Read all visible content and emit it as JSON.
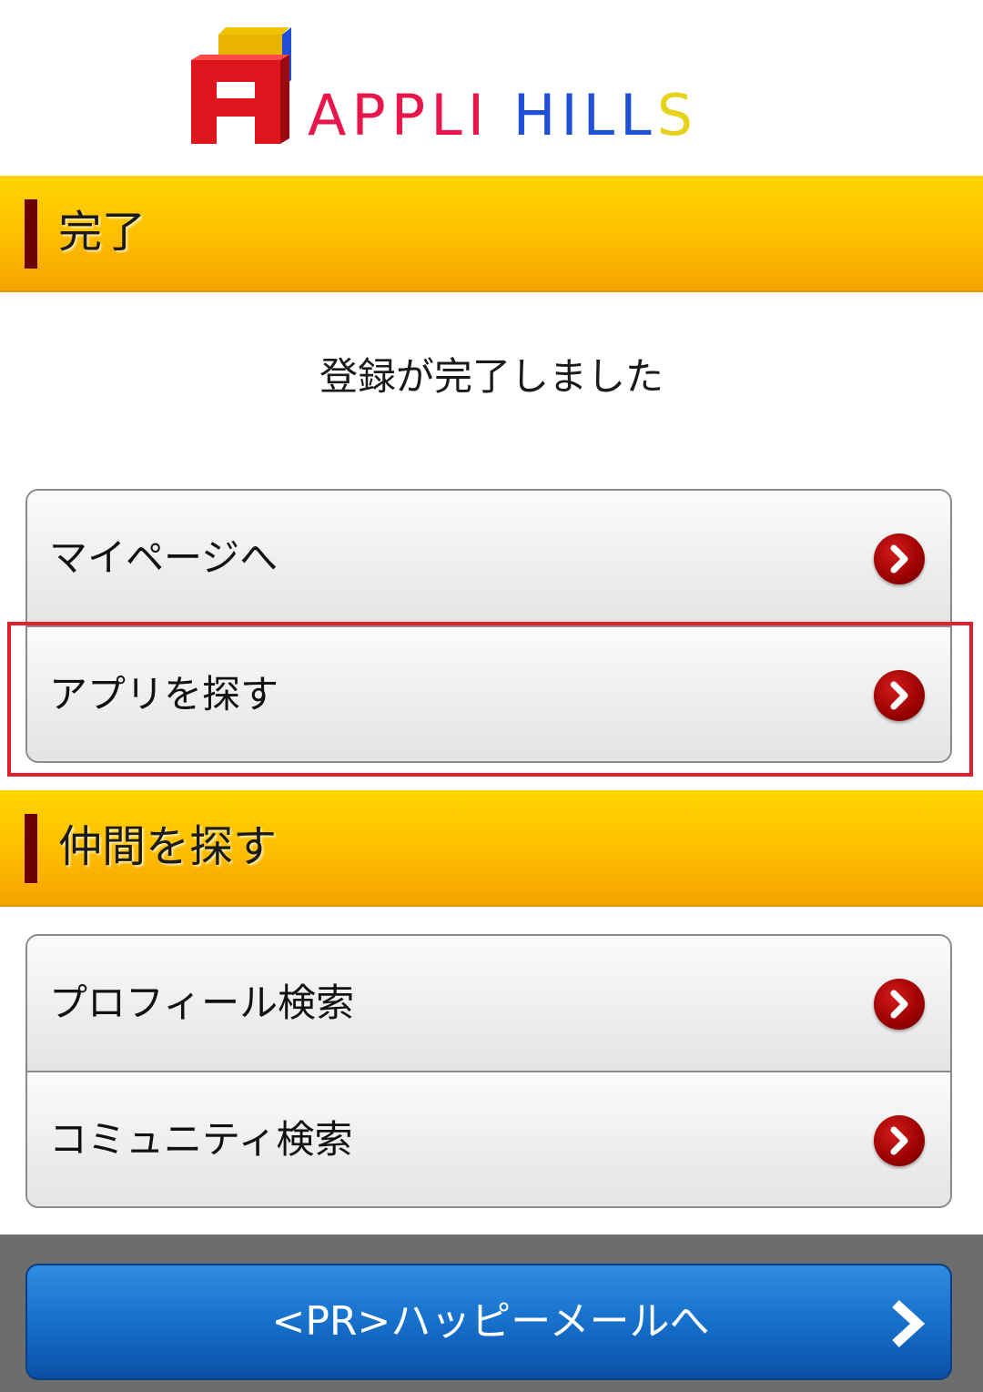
{
  "logo": {
    "parts": [
      "APPLI",
      "HILL",
      "S"
    ]
  },
  "section_complete": {
    "title": "完了"
  },
  "message": "登録が完了しました",
  "nav_buttons": [
    {
      "label": "マイページへ"
    },
    {
      "label": "アプリを探す"
    }
  ],
  "section_friends": {
    "title": "仲間を探す"
  },
  "search_buttons": [
    {
      "label": "プロフィール検索"
    },
    {
      "label": "コミュニティ検索"
    }
  ],
  "footer": {
    "pr_label": "<PR>ハッピーメールへ"
  },
  "colors": {
    "accent_orange": "#ffc200",
    "marker": "#6b0000",
    "chevron": "#9a0000",
    "pr_blue": "#1670cc",
    "highlight": "#e0202a"
  }
}
